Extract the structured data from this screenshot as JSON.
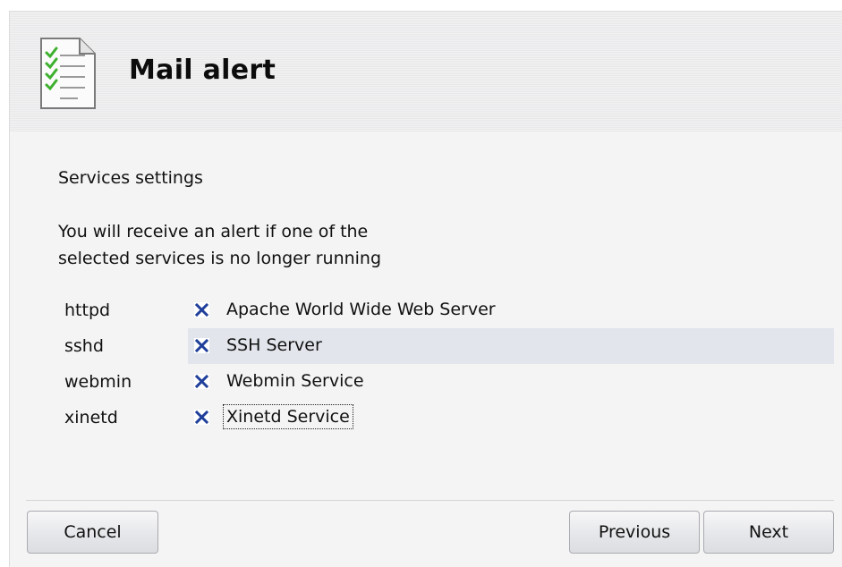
{
  "window": {
    "title": "Mail alert",
    "icon": "checklist-document-icon"
  },
  "content": {
    "section_title": "Services settings",
    "description_line1": "You will receive an alert if one of the",
    "description_line2": "selected services is no longer running"
  },
  "services": [
    {
      "name": "httpd",
      "label": "Apache World Wide Web Server",
      "checked": true,
      "selected": false,
      "focused": false
    },
    {
      "name": "sshd",
      "label": "SSH Server",
      "checked": true,
      "selected": true,
      "focused": false
    },
    {
      "name": "webmin",
      "label": "Webmin Service",
      "checked": true,
      "selected": false,
      "focused": false
    },
    {
      "name": "xinetd",
      "label": "Xinetd Service",
      "checked": true,
      "selected": false,
      "focused": true
    }
  ],
  "buttons": {
    "cancel": "Cancel",
    "previous": "Previous",
    "next": "Next"
  },
  "colors": {
    "check_mark": "#1f3f9a",
    "selected_row": "#e2e6ec",
    "icon_checks": "#3db02e"
  }
}
